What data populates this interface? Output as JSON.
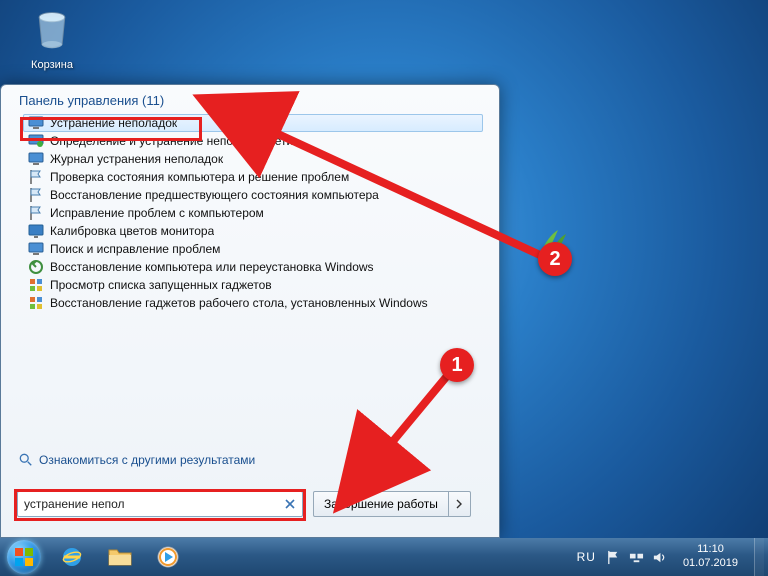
{
  "desktop": {
    "recycle_bin_label": "Корзина"
  },
  "start_menu": {
    "header_text": "Панель управления (11)",
    "items": [
      {
        "label": "Устранение неполадок",
        "icon": "monitor"
      },
      {
        "label": "Определение и устранение неполадок сети",
        "icon": "network"
      },
      {
        "label": "Журнал устранения неполадок",
        "icon": "monitor"
      },
      {
        "label": "Проверка состояния компьютера и решение проблем",
        "icon": "flag"
      },
      {
        "label": "Восстановление предшествующего состояния компьютера",
        "icon": "flag"
      },
      {
        "label": "Исправление проблем с компьютером",
        "icon": "flag"
      },
      {
        "label": "Калибровка цветов монитора",
        "icon": "display"
      },
      {
        "label": "Поиск и исправление проблем",
        "icon": "monitor"
      },
      {
        "label": "Восстановление компьютера или переустановка Windows",
        "icon": "restore"
      },
      {
        "label": "Просмотр списка запущенных гаджетов",
        "icon": "gadget"
      },
      {
        "label": "Восстановление гаджетов рабочего стола, установленных Windows",
        "icon": "gadget"
      }
    ],
    "more_results_label": "Ознакомиться с другими результатами",
    "search_value": "устранение непол",
    "shutdown_label": "Завершение работы"
  },
  "callouts": {
    "step1": "1",
    "step2": "2"
  },
  "taskbar": {
    "lang": "RU",
    "time": "11:10",
    "date": "01.07.2019"
  }
}
